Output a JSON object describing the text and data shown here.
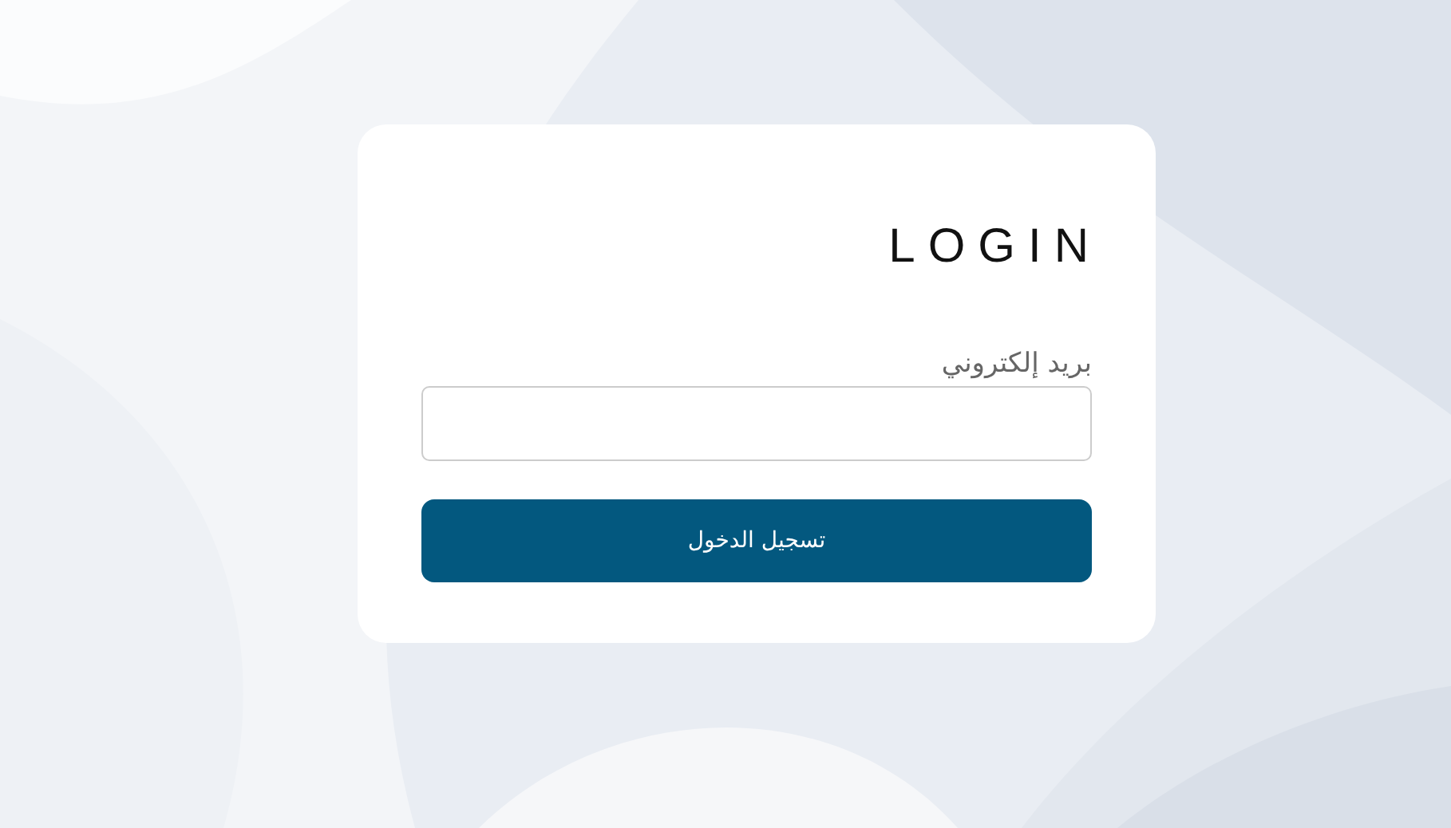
{
  "login_card": {
    "title": "LOGIN",
    "email_label": "بريد إلكتروني",
    "submit_button": "تسجيل الدخول"
  }
}
